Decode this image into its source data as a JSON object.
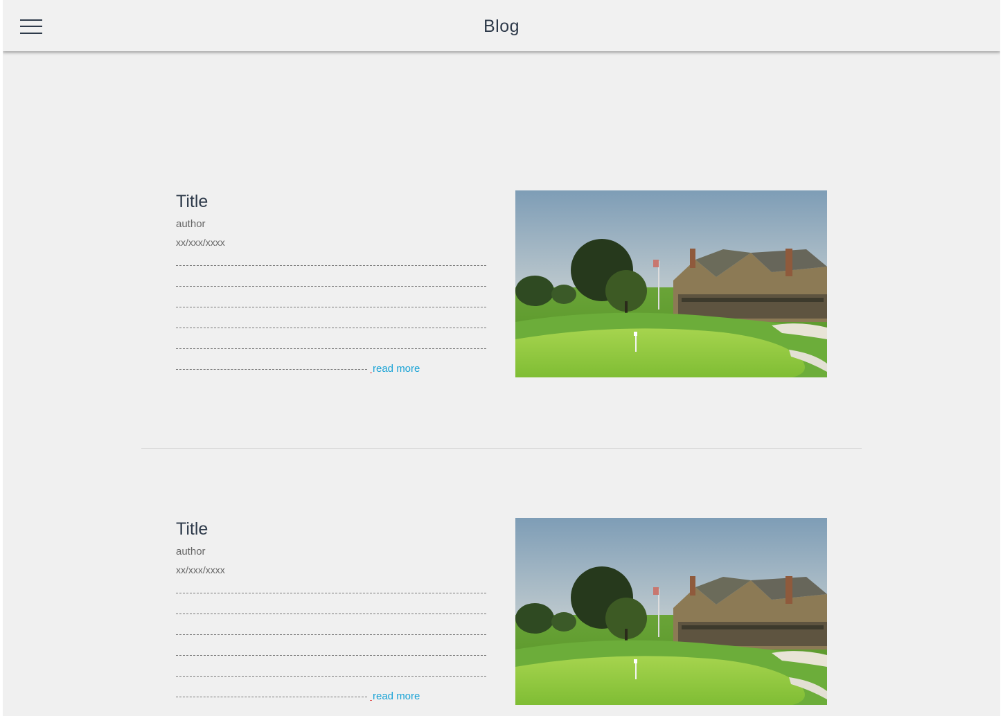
{
  "header": {
    "title": "Blog",
    "menu_icon": "hamburger-menu-icon"
  },
  "posts": [
    {
      "title": "Title",
      "author": "author",
      "date": "xx/xxx/xxxx",
      "read_more": "read more",
      "image": "golf-clubhouse-photo"
    },
    {
      "title": "Title",
      "author": "author",
      "date": "xx/xxx/xxxx",
      "read_more": "read more",
      "image": "golf-clubhouse-photo"
    }
  ],
  "colors": {
    "background": "#f0f0f0",
    "header_text": "#2e3a4a",
    "link": "#1aa3d6",
    "meta_text": "#666666"
  }
}
